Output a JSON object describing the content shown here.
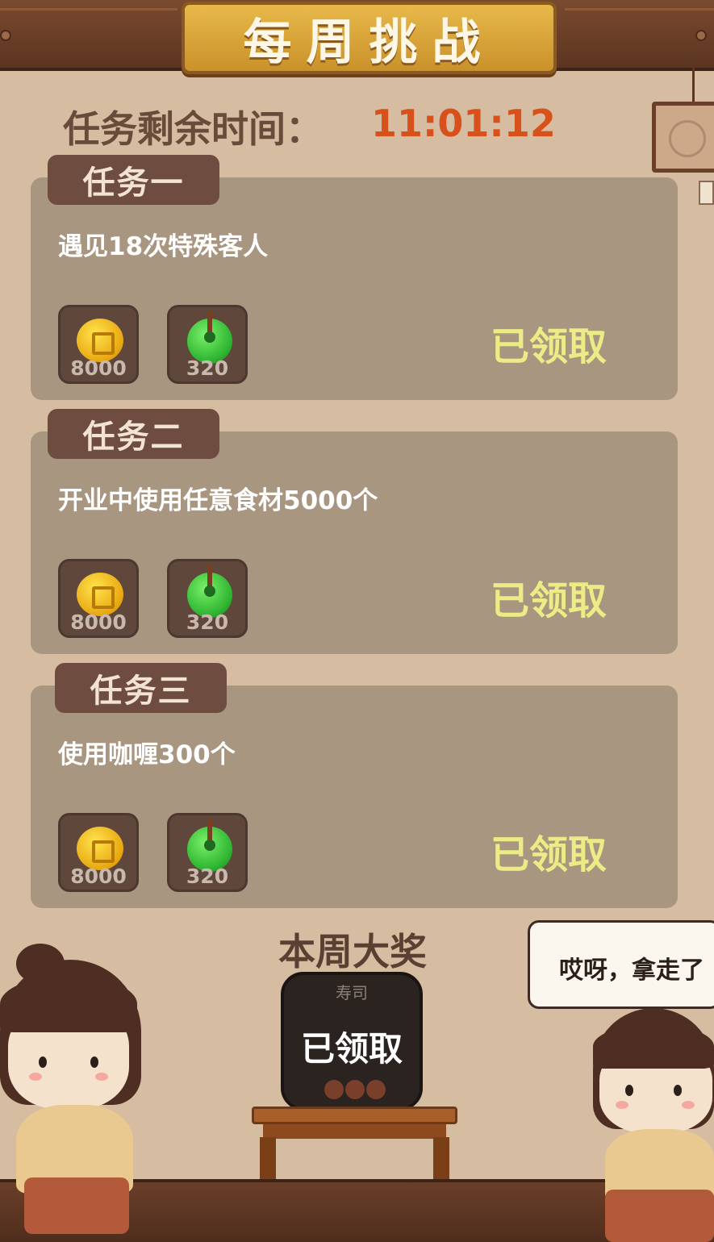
{
  "header": {
    "title": "每周挑战"
  },
  "timer": {
    "label": "任务剩余时间：",
    "value": "11:01:12"
  },
  "tasks": [
    {
      "tab": "任务一",
      "description": "遇见18次特殊客人",
      "rewards": [
        {
          "icon": "coin-icon",
          "amount": "8000"
        },
        {
          "icon": "jade-icon",
          "amount": "320"
        }
      ],
      "status": "已领取"
    },
    {
      "tab": "任务二",
      "description": "开业中使用任意食材5000个",
      "rewards": [
        {
          "icon": "coin-icon",
          "amount": "8000"
        },
        {
          "icon": "jade-icon",
          "amount": "320"
        }
      ],
      "status": "已领取"
    },
    {
      "tab": "任务三",
      "description": "使用咖喱300个",
      "rewards": [
        {
          "icon": "coin-icon",
          "amount": "8000"
        },
        {
          "icon": "jade-icon",
          "amount": "320"
        }
      ],
      "status": "已领取"
    }
  ],
  "grand_prize": {
    "title": "本周大奖",
    "item_name": "寿司",
    "status": "已领取"
  },
  "speech_bubble": {
    "text": "哎呀，拿走了"
  },
  "colors": {
    "timer": "#d8501c",
    "claimed": "#ecec86",
    "banner": "#e0a93c",
    "card": "#a89680"
  }
}
